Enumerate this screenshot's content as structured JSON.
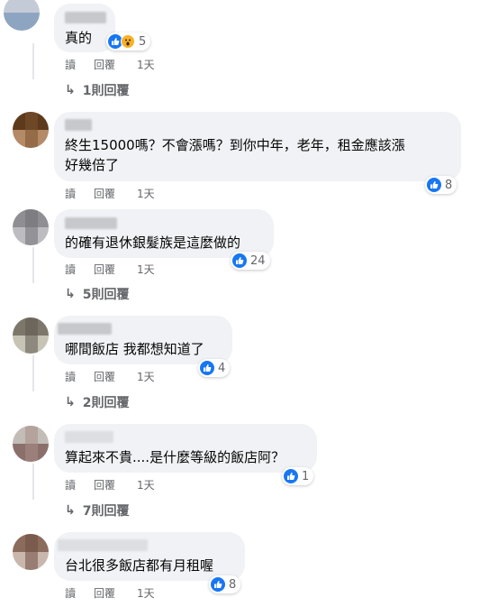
{
  "comments": [
    {
      "text_lines": [
        "真的"
      ],
      "reaction_count": "5",
      "actions": {
        "read": "讀",
        "reply": "回覆",
        "time": "1天"
      },
      "replies_label": "1則回覆",
      "reactions": [
        "like-icon",
        "wow-icon"
      ]
    },
    {
      "text_lines": [
        "終生15000嗎？不會漲嗎？到你中年，老年，租金應該漲",
        "好幾倍了"
      ],
      "reaction_count": "8",
      "actions": {
        "read": "讀",
        "reply": "回覆",
        "time": "1天"
      },
      "reactions": [
        "like-icon"
      ]
    },
    {
      "text_lines": [
        "的確有退休銀髮族是這麼做的"
      ],
      "reaction_count": "24",
      "actions": {
        "read": "讀",
        "reply": "回覆",
        "time": "1天"
      },
      "replies_label": "5則回覆",
      "reactions": [
        "like-icon"
      ]
    },
    {
      "text_lines": [
        "哪間飯店 我都想知道了"
      ],
      "reaction_count": "4",
      "actions": {
        "read": "讀",
        "reply": "回覆",
        "time": "1天"
      },
      "replies_label": "2則回覆",
      "reactions": [
        "like-icon"
      ]
    },
    {
      "text_lines": [
        "算起來不貴....是什麼等級的飯店阿？"
      ],
      "reaction_count": "1",
      "actions": {
        "read": "讀",
        "reply": "回覆",
        "time": "1天"
      },
      "replies_label": "7則回覆",
      "reactions": [
        "like-icon"
      ]
    },
    {
      "text_lines": [
        "台北很多飯店都有月租喔"
      ],
      "reaction_count": "8",
      "actions": {
        "read": "讀",
        "reply": "回覆",
        "time": "1天"
      },
      "reactions": [
        "like-icon"
      ]
    }
  ],
  "colors": {
    "bubble": "#f0f2f5",
    "like_blue": "#1877f2",
    "wow_yellow": "#f7b125",
    "meta_gray": "#65676b"
  }
}
